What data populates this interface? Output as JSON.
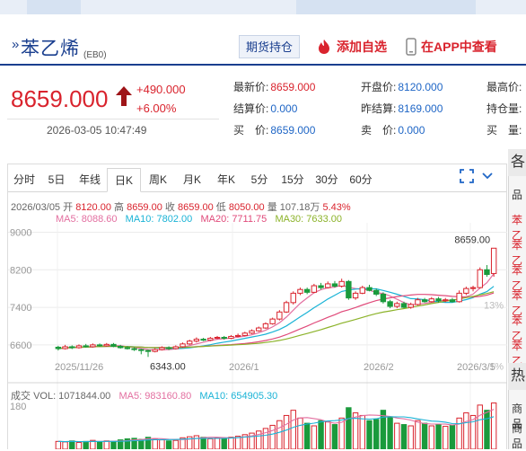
{
  "commodity": {
    "name": "苯乙烯",
    "code": "(EB0)",
    "hold_button": "期货持仓",
    "add_favorite": "添加自选",
    "view_in_app": "在APP中查看"
  },
  "price": {
    "last": "8659.000",
    "change": "+490.000",
    "change_pct": "+6.00%",
    "datetime": "2026-03-05 10:47:49"
  },
  "quote": {
    "rows": [
      [
        {
          "label": "最新价:",
          "value": "8659.000",
          "color": "#d9232d"
        },
        {
          "label": "开盘价:",
          "value": "8120.000",
          "color": "#1f66c6"
        },
        {
          "label": "最高价:",
          "value": "",
          "color": "#d9232d"
        }
      ],
      [
        {
          "label": "结算价:",
          "value": "0.000",
          "color": "#1f66c6"
        },
        {
          "label": "昨结算:",
          "value": "8169.000",
          "color": "#1f66c6"
        },
        {
          "label": "持仓量:",
          "value": "",
          "color": "#1f66c6"
        }
      ],
      [
        {
          "label": "买　价:",
          "value": "8659.000",
          "color": "#1f66c6"
        },
        {
          "label": "卖　价:",
          "value": "0.000",
          "color": "#1f66c6"
        },
        {
          "label": "买　量:",
          "value": "",
          "color": "#1f66c6"
        }
      ]
    ]
  },
  "tabs": [
    "分时",
    "5日",
    "年线",
    "日K",
    "周K",
    "月K",
    "年K",
    "5分",
    "15分",
    "30分",
    "60分"
  ],
  "active_tab": "日K",
  "side": {
    "header": "各",
    "items": [
      "品",
      "苯乙",
      "苯乙",
      "苯乙",
      "苯乙",
      "苯乙",
      "苯乙"
    ],
    "header2": "热",
    "items2": [
      "商品",
      "商品"
    ]
  },
  "ohlc_info": {
    "date": "2026/03/05",
    "open_label": "开",
    "open": "8120.00",
    "high_label": "高",
    "high": "8659.00",
    "close_label": "收",
    "close": "8659.00",
    "low_label": "低",
    "low": "8050.00",
    "vol_label": "量",
    "vol": "107.18万",
    "pct": "5.43%"
  },
  "ma": {
    "ma5": "MA5: 8088.60",
    "ma10": "MA10: 7802.00",
    "ma20": "MA20: 7711.75",
    "ma30": "MA30: 7633.00"
  },
  "volume_info": {
    "label": "成交",
    "vol": "VOL: 1071844.00",
    "ma5": "MA5: 983160.80",
    "ma10": "MA10: 654905.30"
  },
  "colors": {
    "up": "#d9232d",
    "down": "#1a9a3c",
    "ma5": "#e36fa0",
    "ma10": "#1ab3d6",
    "ma20": "#e04a7a",
    "ma30": "#8cb32a",
    "brand": "#1a3f8f"
  },
  "chart_data": {
    "type": "candlestick",
    "y_ticks": [
      "9000",
      "8200",
      "7400",
      "6600"
    ],
    "pct_ticks": [
      "13%",
      "1%"
    ],
    "x_ticks": [
      "2025/11/26",
      "2026/1",
      "2026/2",
      "2026/3/5"
    ],
    "ylim": [
      6100,
      9200
    ],
    "vol_tick": "180",
    "annotations": {
      "max_label": "8659.00",
      "min_label": "6343.00"
    },
    "candles": [
      {
        "o": 6550,
        "c": 6520,
        "h": 6580,
        "l": 6480
      },
      {
        "o": 6520,
        "c": 6560,
        "h": 6600,
        "l": 6500
      },
      {
        "o": 6560,
        "c": 6540,
        "h": 6590,
        "l": 6510
      },
      {
        "o": 6540,
        "c": 6580,
        "h": 6610,
        "l": 6520
      },
      {
        "o": 6580,
        "c": 6560,
        "h": 6620,
        "l": 6540
      },
      {
        "o": 6560,
        "c": 6600,
        "h": 6630,
        "l": 6540
      },
      {
        "o": 6600,
        "c": 6580,
        "h": 6630,
        "l": 6560
      },
      {
        "o": 6580,
        "c": 6610,
        "h": 6640,
        "l": 6560
      },
      {
        "o": 6610,
        "c": 6570,
        "h": 6640,
        "l": 6550
      },
      {
        "o": 6570,
        "c": 6540,
        "h": 6600,
        "l": 6520
      },
      {
        "o": 6540,
        "c": 6520,
        "h": 6570,
        "l": 6500
      },
      {
        "o": 6520,
        "c": 6500,
        "h": 6550,
        "l": 6470
      },
      {
        "o": 6500,
        "c": 6480,
        "h": 6520,
        "l": 6400
      },
      {
        "o": 6480,
        "c": 6460,
        "h": 6500,
        "l": 6343
      },
      {
        "o": 6460,
        "c": 6500,
        "h": 6530,
        "l": 6440
      },
      {
        "o": 6500,
        "c": 6540,
        "h": 6570,
        "l": 6480
      },
      {
        "o": 6540,
        "c": 6520,
        "h": 6570,
        "l": 6490
      },
      {
        "o": 6520,
        "c": 6560,
        "h": 6590,
        "l": 6500
      },
      {
        "o": 6560,
        "c": 6620,
        "h": 6650,
        "l": 6540
      },
      {
        "o": 6620,
        "c": 6680,
        "h": 6710,
        "l": 6600
      },
      {
        "o": 6680,
        "c": 6720,
        "h": 6760,
        "l": 6650
      },
      {
        "o": 6720,
        "c": 6700,
        "h": 6750,
        "l": 6680
      },
      {
        "o": 6700,
        "c": 6740,
        "h": 6770,
        "l": 6680
      },
      {
        "o": 6740,
        "c": 6760,
        "h": 6790,
        "l": 6720
      },
      {
        "o": 6760,
        "c": 6740,
        "h": 6790,
        "l": 6710
      },
      {
        "o": 6740,
        "c": 6780,
        "h": 6810,
        "l": 6720
      },
      {
        "o": 6780,
        "c": 6800,
        "h": 6840,
        "l": 6760
      },
      {
        "o": 6800,
        "c": 6850,
        "h": 6880,
        "l": 6780
      },
      {
        "o": 6850,
        "c": 6900,
        "h": 6930,
        "l": 6830
      },
      {
        "o": 6900,
        "c": 6960,
        "h": 6990,
        "l": 6880
      },
      {
        "o": 6960,
        "c": 7050,
        "h": 7080,
        "l": 6940
      },
      {
        "o": 7050,
        "c": 7150,
        "h": 7180,
        "l": 7030
      },
      {
        "o": 7150,
        "c": 7300,
        "h": 7340,
        "l": 7120
      },
      {
        "o": 7300,
        "c": 7500,
        "h": 7540,
        "l": 7280
      },
      {
        "o": 7500,
        "c": 7700,
        "h": 7740,
        "l": 7460
      },
      {
        "o": 7700,
        "c": 7780,
        "h": 7820,
        "l": 7660
      },
      {
        "o": 7780,
        "c": 7720,
        "h": 7820,
        "l": 7680
      },
      {
        "o": 7720,
        "c": 7860,
        "h": 7900,
        "l": 7700
      },
      {
        "o": 7860,
        "c": 7820,
        "h": 7920,
        "l": 7780
      },
      {
        "o": 7820,
        "c": 7900,
        "h": 7950,
        "l": 7800
      },
      {
        "o": 7900,
        "c": 7850,
        "h": 7960,
        "l": 7820
      },
      {
        "o": 7850,
        "c": 7950,
        "h": 8010,
        "l": 7820
      },
      {
        "o": 7950,
        "c": 7600,
        "h": 7980,
        "l": 7560
      },
      {
        "o": 7600,
        "c": 7700,
        "h": 7740,
        "l": 7560
      },
      {
        "o": 7700,
        "c": 7820,
        "h": 7860,
        "l": 7680
      },
      {
        "o": 7820,
        "c": 7760,
        "h": 7880,
        "l": 7740
      },
      {
        "o": 7760,
        "c": 7680,
        "h": 7800,
        "l": 7640
      },
      {
        "o": 7680,
        "c": 7520,
        "h": 7720,
        "l": 7480
      },
      {
        "o": 7520,
        "c": 7420,
        "h": 7560,
        "l": 7380
      },
      {
        "o": 7420,
        "c": 7480,
        "h": 7520,
        "l": 7380
      },
      {
        "o": 7480,
        "c": 7400,
        "h": 7520,
        "l": 7380
      },
      {
        "o": 7400,
        "c": 7460,
        "h": 7500,
        "l": 7370
      },
      {
        "o": 7460,
        "c": 7560,
        "h": 7600,
        "l": 7440
      },
      {
        "o": 7560,
        "c": 7520,
        "h": 7600,
        "l": 7500
      },
      {
        "o": 7520,
        "c": 7580,
        "h": 7620,
        "l": 7500
      },
      {
        "o": 7580,
        "c": 7540,
        "h": 7620,
        "l": 7500
      },
      {
        "o": 7540,
        "c": 7560,
        "h": 7600,
        "l": 7510
      },
      {
        "o": 7560,
        "c": 7520,
        "h": 7600,
        "l": 7500
      },
      {
        "o": 7520,
        "c": 7700,
        "h": 7760,
        "l": 7500
      },
      {
        "o": 7700,
        "c": 7800,
        "h": 7840,
        "l": 7660
      },
      {
        "o": 7800,
        "c": 7820,
        "h": 7860,
        "l": 7740
      },
      {
        "o": 7820,
        "c": 8200,
        "h": 8250,
        "l": 7800
      },
      {
        "o": 8200,
        "c": 8100,
        "h": 8300,
        "l": 8050
      },
      {
        "o": 8120,
        "c": 8659,
        "h": 8659,
        "l": 8050
      }
    ],
    "volumes": [
      30,
      28,
      32,
      26,
      30,
      34,
      28,
      32,
      30,
      36,
      40,
      42,
      38,
      46,
      40,
      36,
      32,
      34,
      44,
      48,
      52,
      46,
      40,
      44,
      42,
      46,
      50,
      56,
      62,
      70,
      80,
      92,
      110,
      130,
      150,
      120,
      100,
      90,
      110,
      105,
      95,
      120,
      160,
      140,
      130,
      110,
      115,
      150,
      125,
      100,
      95,
      90,
      110,
      100,
      90,
      95,
      88,
      92,
      120,
      140,
      130,
      170,
      150,
      178
    ],
    "vol_up": [
      true,
      true,
      false,
      true,
      false,
      true,
      false,
      true,
      false,
      false,
      false,
      false,
      false,
      false,
      true,
      true,
      false,
      true,
      true,
      true,
      true,
      false,
      true,
      true,
      false,
      true,
      true,
      true,
      true,
      true,
      true,
      true,
      true,
      true,
      true,
      true,
      false,
      true,
      false,
      true,
      false,
      true,
      false,
      true,
      true,
      false,
      false,
      false,
      false,
      true,
      false,
      true,
      true,
      false,
      true,
      false,
      true,
      false,
      true,
      true,
      true,
      true,
      false,
      true
    ]
  }
}
